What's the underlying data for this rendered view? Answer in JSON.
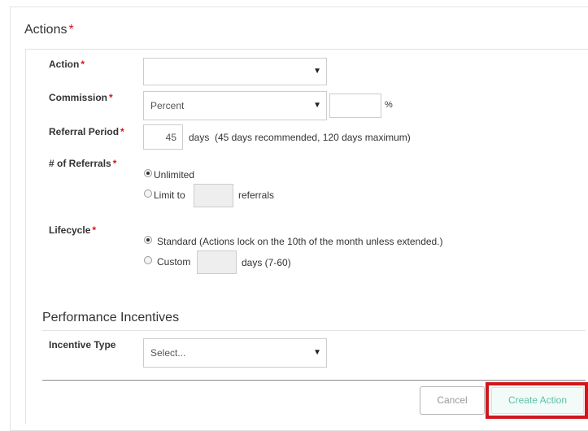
{
  "actions": {
    "title": "Actions",
    "required_mark": "*"
  },
  "form": {
    "action": {
      "label": "Action",
      "req": "*",
      "selected": ""
    },
    "commission": {
      "label": "Commission",
      "req": "*",
      "type_selected": "Percent",
      "value": "",
      "unit": "%"
    },
    "referral_period": {
      "label": "Referral Period",
      "req": "*",
      "value": "45",
      "unit": "days",
      "note": "(45 days recommended, 120 days maximum)"
    },
    "num_referrals": {
      "label": "# of Referrals",
      "req": "*",
      "option_unlimited": "Unlimited",
      "option_limit": "Limit to",
      "limit_value": "",
      "limit_suffix": "referrals"
    },
    "lifecycle": {
      "label": "Lifecycle",
      "req": "*",
      "option_standard": "Standard (Actions lock on the 10th of the month unless extended.)",
      "option_custom": "Custom",
      "custom_value": "",
      "custom_suffix": "days (7-60)"
    }
  },
  "performance": {
    "title": "Performance Incentives",
    "incentive_type": {
      "label": "Incentive Type",
      "selected": "Select..."
    }
  },
  "buttons": {
    "cancel": "Cancel",
    "create": "Create Action"
  },
  "icons": {
    "dropdown": "▼"
  },
  "colors": {
    "required": "#d0161b",
    "create_text": "#5bc0a8",
    "highlight_border": "#d0161b"
  }
}
